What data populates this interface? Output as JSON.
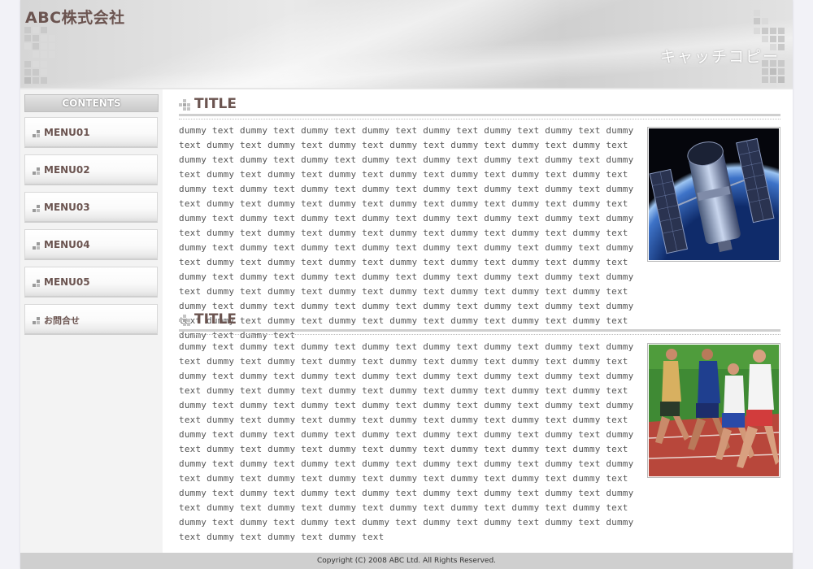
{
  "header": {
    "company": "ABC株式会社",
    "catchcopy": "キャッチコピー"
  },
  "sidebar": {
    "contents_label": "CONTENTS",
    "items": [
      {
        "label": "MENU01"
      },
      {
        "label": "MENU02"
      },
      {
        "label": "MENU03"
      },
      {
        "label": "MENU04"
      },
      {
        "label": "MENU05"
      },
      {
        "label": "お問合せ"
      }
    ]
  },
  "sections": [
    {
      "title": "TITLE",
      "text": "dummy text dummy text dummy text dummy text dummy text dummy text dummy text dummy text dummy text dummy text dummy text dummy text dummy text dummy text dummy text dummy text dummy text dummy text dummy text dummy text dummy text dummy text dummy text dummy text dummy text dummy text dummy text dummy text dummy text dummy text dummy text dummy text dummy text dummy text dummy text dummy text dummy text dummy text dummy text dummy text dummy text dummy text dummy text dummy text dummy text dummy text dummy text dummy text dummy text dummy text dummy text dummy text dummy text dummy text dummy text dummy text dummy text dummy text dummy text dummy text dummy text dummy text dummy text dummy text dummy text dummy text dummy text dummy text dummy text dummy text dummy text dummy text dummy text dummy text dummy text dummy text dummy text dummy text dummy text dummy text dummy text dummy text dummy text dummy text dummy text dummy text dummy text dummy text dummy text dummy text dummy text dummy text dummy text dummy text dummy text dummy text dummy text dummy text dummy text dummy text dummy text dummy text dummy text dummy text dummy text dummy text dummy text",
      "image": "satellite-photo"
    },
    {
      "title": "TITLE",
      "text": "dummy text dummy text dummy text dummy text dummy text dummy text dummy text dummy text dummy text dummy text dummy text dummy text dummy text dummy text dummy text dummy text dummy text dummy text dummy text dummy text dummy text dummy text dummy text dummy text dummy text dummy text dummy text dummy text dummy text dummy text dummy text dummy text dummy text dummy text dummy text dummy text dummy text dummy text dummy text dummy text dummy text dummy text dummy text dummy text dummy text dummy text dummy text dummy text dummy text dummy text dummy text dummy text dummy text dummy text dummy text dummy text dummy text dummy text dummy text dummy text dummy text dummy text dummy text dummy text dummy text dummy text dummy text dummy text dummy text dummy text dummy text dummy text dummy text dummy text dummy text dummy text dummy text dummy text dummy text dummy text dummy text dummy text dummy text dummy text dummy text dummy text dummy text dummy text dummy text dummy text dummy text dummy text dummy text dummy text dummy text dummy text dummy text dummy text dummy text dummy text dummy text",
      "image": "runners-photo"
    }
  ],
  "footer": {
    "copyright": "Copyright (C) 2008 ABC Ltd. All Rights Reserved."
  },
  "colors": {
    "brand_text": "#6b5450",
    "page_bg": "#f2f2f7",
    "footer_bg": "#cfcfcf"
  }
}
